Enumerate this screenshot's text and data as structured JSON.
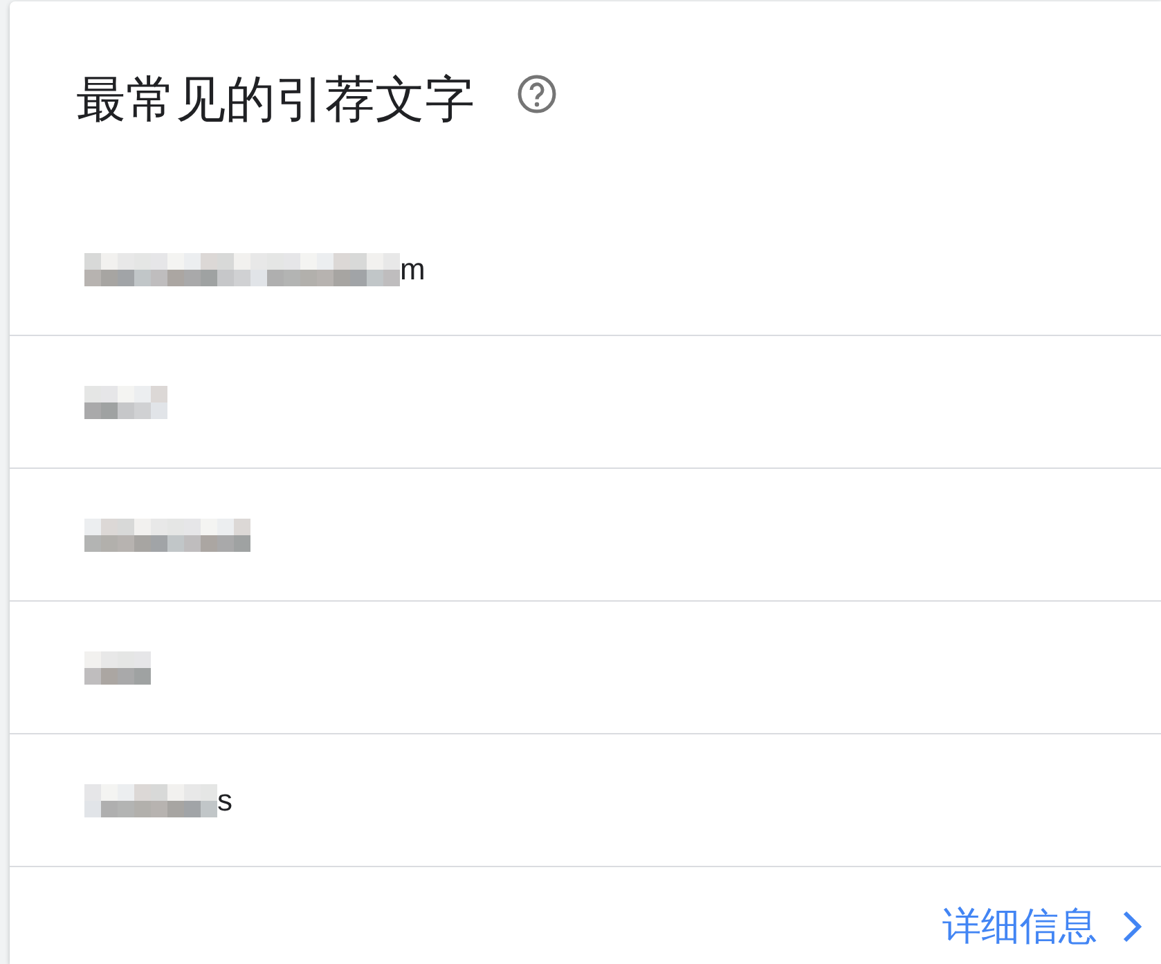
{
  "card": {
    "title": "最常见的引荐文字",
    "rows": [
      {
        "masked": true,
        "suffix": "m"
      },
      {
        "masked": true
      },
      {
        "masked": true
      },
      {
        "masked": true
      },
      {
        "masked": true,
        "suffix": "s"
      }
    ],
    "link": {
      "label": "详细信息"
    }
  }
}
